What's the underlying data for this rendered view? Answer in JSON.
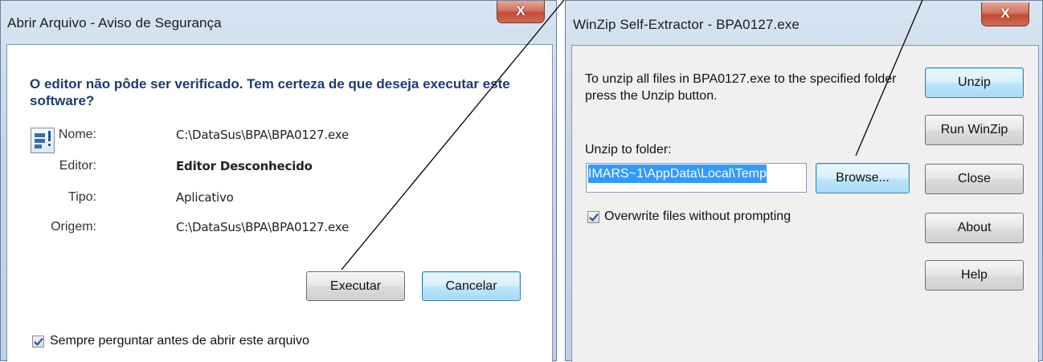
{
  "security_dialog": {
    "title": "Abrir Arquivo - Aviso de Segurança",
    "close_glyph": "X",
    "heading": "O editor não pôde ser verificado.  Tem certeza de que deseja executar este software?",
    "icon": "application-icon",
    "fields": [
      {
        "label": "Nome:",
        "value": "C:\\DataSus\\BPA\\BPA0127.exe",
        "bold": false
      },
      {
        "label": "Editor:",
        "value": "Editor Desconhecido",
        "bold": true
      },
      {
        "label": "Tipo:",
        "value": "Aplicativo",
        "bold": false
      },
      {
        "label": "Origem:",
        "value": "C:\\DataSus\\BPA\\BPA0127.exe",
        "bold": false
      }
    ],
    "run_label": "Executar",
    "cancel_label": "Cancelar",
    "always_ask_label": "Sempre perguntar antes de abrir este arquivo",
    "always_ask_checked": true
  },
  "winzip_dialog": {
    "title": "WinZip Self-Extractor - BPA0127.exe",
    "close_glyph": "X",
    "instructions": "To unzip all files in BPA0127.exe to the specified folder press the Unzip button.",
    "folder_label": "Unzip to folder:",
    "folder_value": "IMARS~1\\AppData\\Local\\Temp",
    "browse_label": "Browse...",
    "overwrite_label": "Overwrite files without prompting",
    "overwrite_checked": true,
    "buttons": {
      "unzip": "Unzip",
      "run_winzip": "Run WinZip",
      "close": "Close",
      "about": "About",
      "help": "Help"
    }
  },
  "colors": {
    "heading": "#1c3c6e",
    "selection": "#3399ff",
    "close_button": "#c24b34",
    "annotation_line": "#000000"
  }
}
